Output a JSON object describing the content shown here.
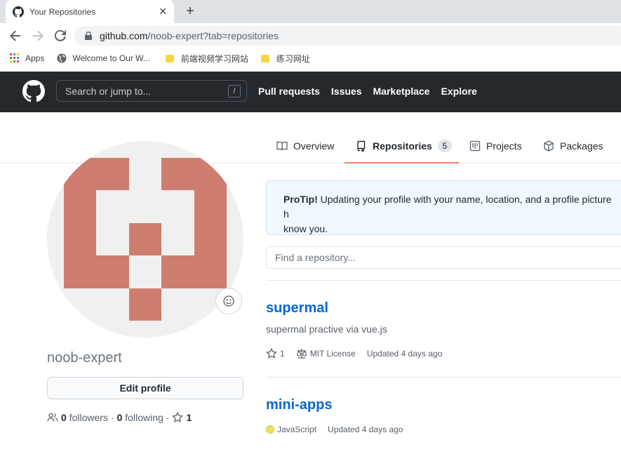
{
  "browser": {
    "tab_title": "Your Repositories",
    "tab_close": "✕",
    "new_tab": "+",
    "url_host": "github.com",
    "url_path": "/noob-expert?tab=repositories",
    "bookmarks": {
      "apps": "Apps",
      "welcome": "Welcome to Our W...",
      "folder1": "前端视频学习网站",
      "folder2": "练习网址"
    }
  },
  "header": {
    "search_placeholder": "Search or jump to...",
    "search_shortcut": "/",
    "nav": [
      "Pull requests",
      "Issues",
      "Marketplace",
      "Explore"
    ]
  },
  "profile_tabs": {
    "overview": "Overview",
    "repositories": "Repositories",
    "repositories_count": "5",
    "projects": "Projects",
    "packages": "Packages"
  },
  "profile": {
    "username": "noob-expert",
    "edit_label": "Edit profile",
    "followers_count": "0",
    "followers_label": "followers",
    "following_count": "0",
    "following_label": "following",
    "stars_count": "1",
    "sep": "·",
    "avatar_color": "#cf7d6f"
  },
  "protip": {
    "bold": "ProTip!",
    "text": " Updating your profile with your name, location, and a profile picture h",
    "text2": "know you."
  },
  "repo_search": {
    "placeholder": "Find a repository..."
  },
  "repos": [
    {
      "name": "supermal",
      "description": "supermal practive via vue.js",
      "stars": "1",
      "license": "MIT License",
      "updated": "Updated 4 days ago"
    },
    {
      "name": "mini-apps",
      "language": "JavaScript",
      "updated": "Updated 4 days ago"
    }
  ]
}
